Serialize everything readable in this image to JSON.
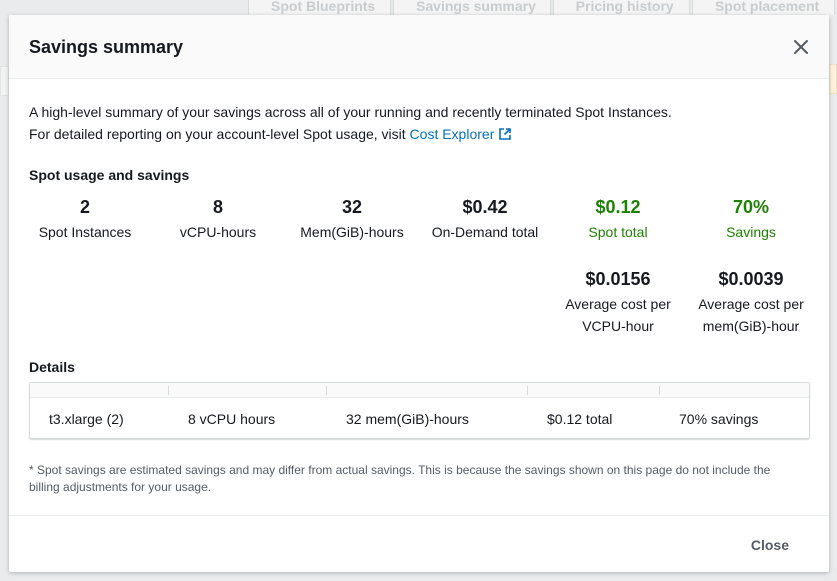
{
  "background": {
    "tabs": [
      "Spot Blueprints",
      "Savings summary",
      "Pricing history",
      "Spot placement"
    ]
  },
  "modal": {
    "title": "Savings summary",
    "intro_line1": "A high-level summary of your savings across all of your running and recently terminated Spot Instances.",
    "intro_line2": "For detailed reporting on your account-level Spot usage, visit",
    "cost_explorer_link": "Cost Explorer",
    "usage_section_title": "Spot usage and savings",
    "stats": [
      {
        "value": "2",
        "label": "Spot Instances"
      },
      {
        "value": "8",
        "label": "vCPU-hours"
      },
      {
        "value": "32",
        "label": "Mem(GiB)-hours"
      },
      {
        "value": "$0.42",
        "label": "On-Demand total"
      },
      {
        "value": "$0.12",
        "label": "Spot total"
      },
      {
        "value": "70%",
        "label": "Savings"
      }
    ],
    "averages": [
      {
        "value": "$0.0156",
        "label_line1": "Average cost per",
        "label_line2": "VCPU-hour"
      },
      {
        "value": "$0.0039",
        "label_line1": "Average cost per",
        "label_line2": "mem(GiB)-hour"
      }
    ],
    "details_title": "Details",
    "details_row": {
      "instance": "t3.xlarge (2)",
      "vcpu": "8 vCPU hours",
      "mem": "32 mem(GiB)-hours",
      "total": "$0.12 total",
      "savings": "70% savings"
    },
    "footnote": "* Spot savings are estimated savings and may differ from actual savings. This is because the savings shown on this page do not include the billing adjustments for your usage.",
    "close_button": "Close"
  },
  "colors": {
    "link": "#0073bb",
    "savings_green": "#1d8102",
    "text": "#16191f",
    "muted": "#545b64"
  },
  "icons": [
    "close-icon",
    "external-link-icon"
  ]
}
